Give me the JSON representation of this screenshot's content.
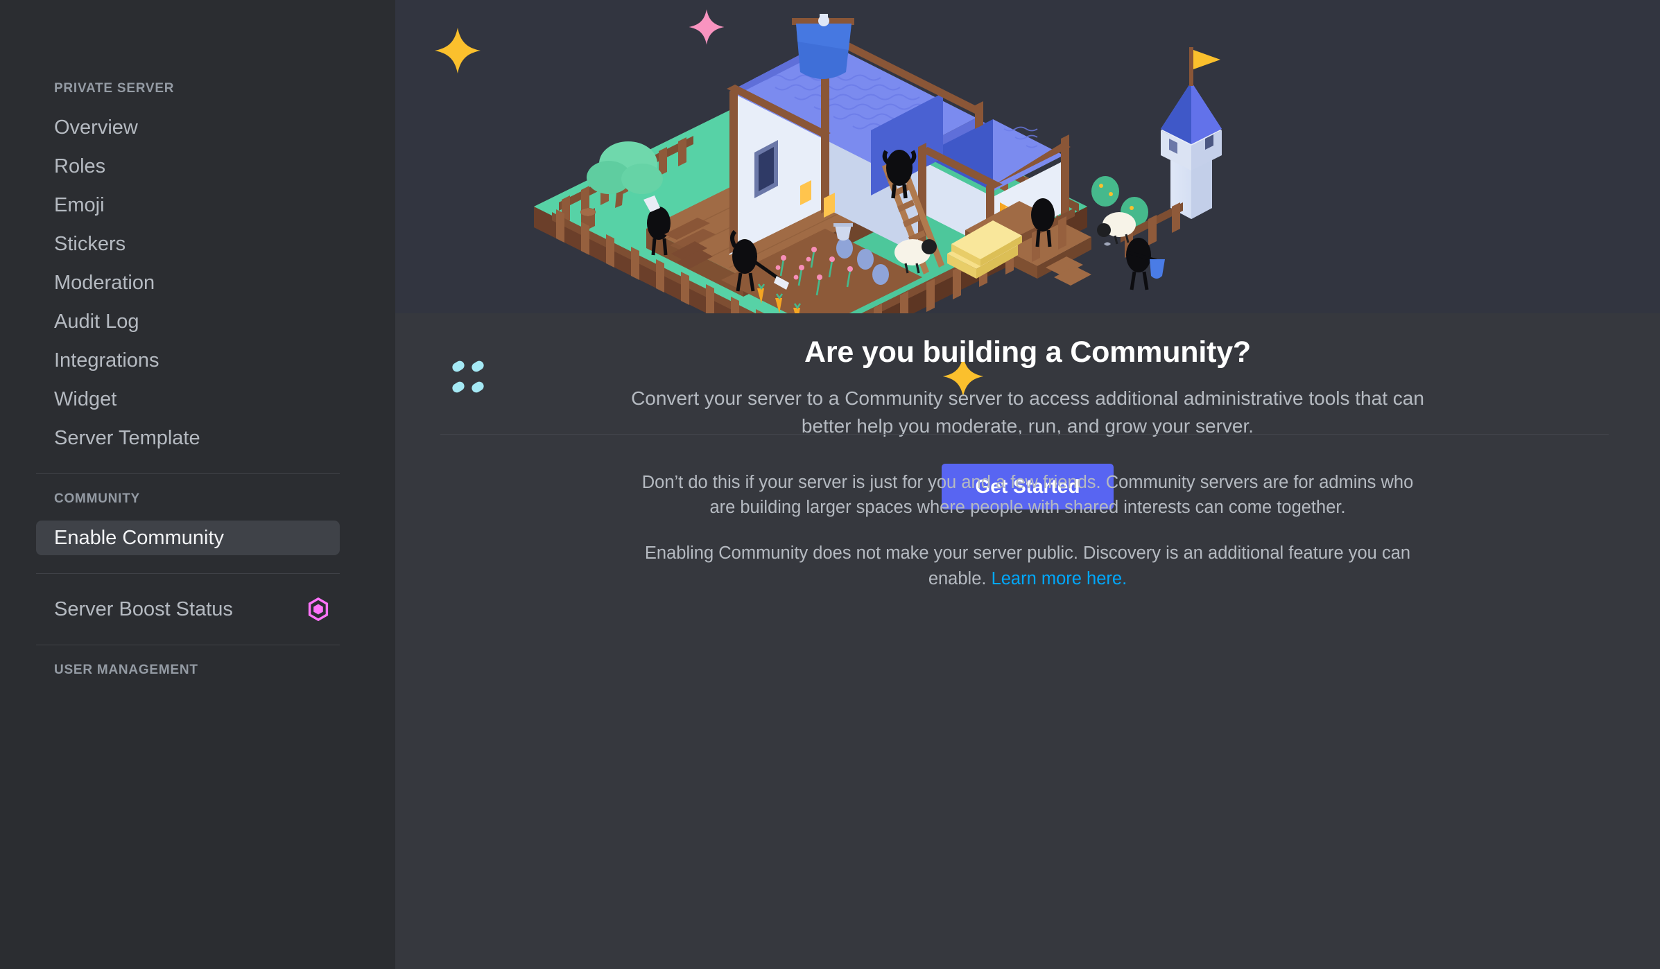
{
  "sidebar": {
    "sections": [
      {
        "title": "PRIVATE SERVER",
        "items": [
          {
            "label": "Overview"
          },
          {
            "label": "Roles"
          },
          {
            "label": "Emoji"
          },
          {
            "label": "Stickers"
          },
          {
            "label": "Moderation"
          },
          {
            "label": "Audit Log"
          },
          {
            "label": "Integrations"
          },
          {
            "label": "Widget"
          },
          {
            "label": "Server Template"
          }
        ]
      },
      {
        "title": "COMMUNITY",
        "items": [
          {
            "label": "Enable Community",
            "active": true
          }
        ]
      },
      {
        "title": "",
        "items": [
          {
            "label": "Server Boost Status",
            "icon": "boost-gem-icon"
          }
        ]
      },
      {
        "title": "USER MANAGEMENT",
        "items": []
      }
    ]
  },
  "hero": {
    "illustration_name": "community-village-illustration",
    "heading": "Are you building a Community?",
    "subheading": "Convert your server to a Community server to access additional administrative tools that can better help you moderate, run, and grow your server.",
    "cta_label": "Get Started"
  },
  "footnotes": {
    "paragraph_1": "Don’t do this if your server is just for you and a few friends. Community servers are for admins who are building larger spaces where people with shared interests can come together.",
    "paragraph_2_text": "Enabling Community does not make your server public. Discovery is an additional feature you can enable. ",
    "paragraph_2_link": "Learn more here."
  },
  "colors": {
    "sidebar_bg": "#2b2d31",
    "main_bg": "#36383e",
    "banner_bg": "#323540",
    "accent_blurple": "#5865f2",
    "link_blue": "#00a8fc",
    "boost_pink": "#ff73fa",
    "text_muted": "#b5bac1",
    "header_muted": "#949ba4",
    "active_item_bg": "#3f4248",
    "sparkle_gold": "#fbc02d",
    "sparkle_pink": "#f994c0",
    "sparkle_cyan": "#a5e9f5"
  }
}
